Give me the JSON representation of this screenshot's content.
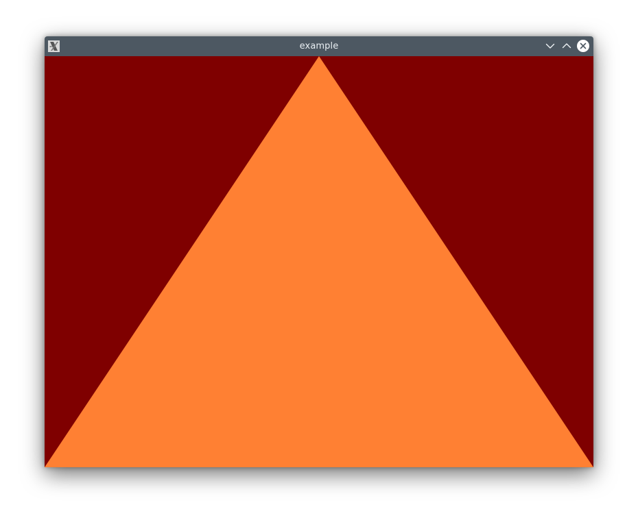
{
  "window": {
    "title": "example",
    "app_icon": "x11-app-icon",
    "buttons": {
      "minimize": "chevron-down-icon",
      "maximize": "chevron-up-icon",
      "close": "close-icon"
    }
  },
  "scene": {
    "background_color": "#7f0000",
    "triangle_color": "#ff8033",
    "shape": "triangle"
  },
  "colors": {
    "titlebar": "#4d5862",
    "title_text": "#e9eef2"
  }
}
